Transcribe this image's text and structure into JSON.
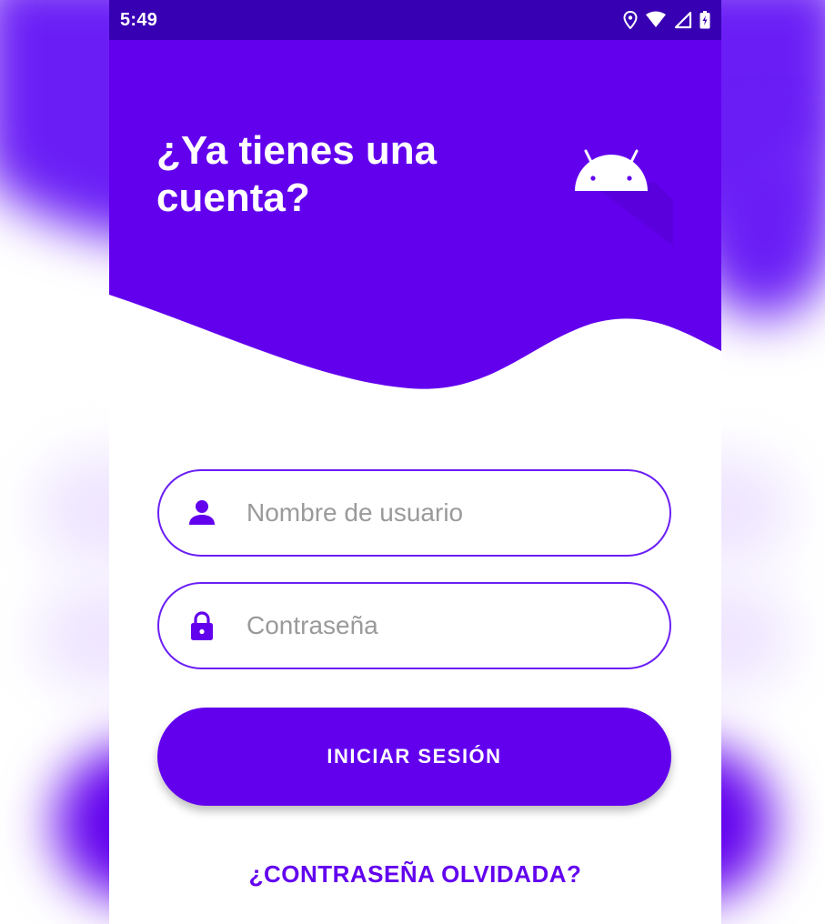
{
  "status_bar": {
    "time": "5:49",
    "icons": [
      "location-icon",
      "wifi-icon",
      "signal-icon",
      "battery-icon"
    ]
  },
  "header": {
    "title": "¿Ya tienes una cuenta?",
    "logo": "android-icon"
  },
  "form": {
    "username": {
      "placeholder": "Nombre de usuario",
      "value": "",
      "icon": "person-icon"
    },
    "password": {
      "placeholder": "Contraseña",
      "value": "",
      "icon": "lock-icon"
    },
    "login_label": "INICIAR SESIÓN",
    "forgot_label": "¿CONTRASEÑA OLVIDADA?"
  },
  "colors": {
    "primary": "#6200ee",
    "primary_dark": "#3700b3",
    "background": "#ffffff"
  }
}
